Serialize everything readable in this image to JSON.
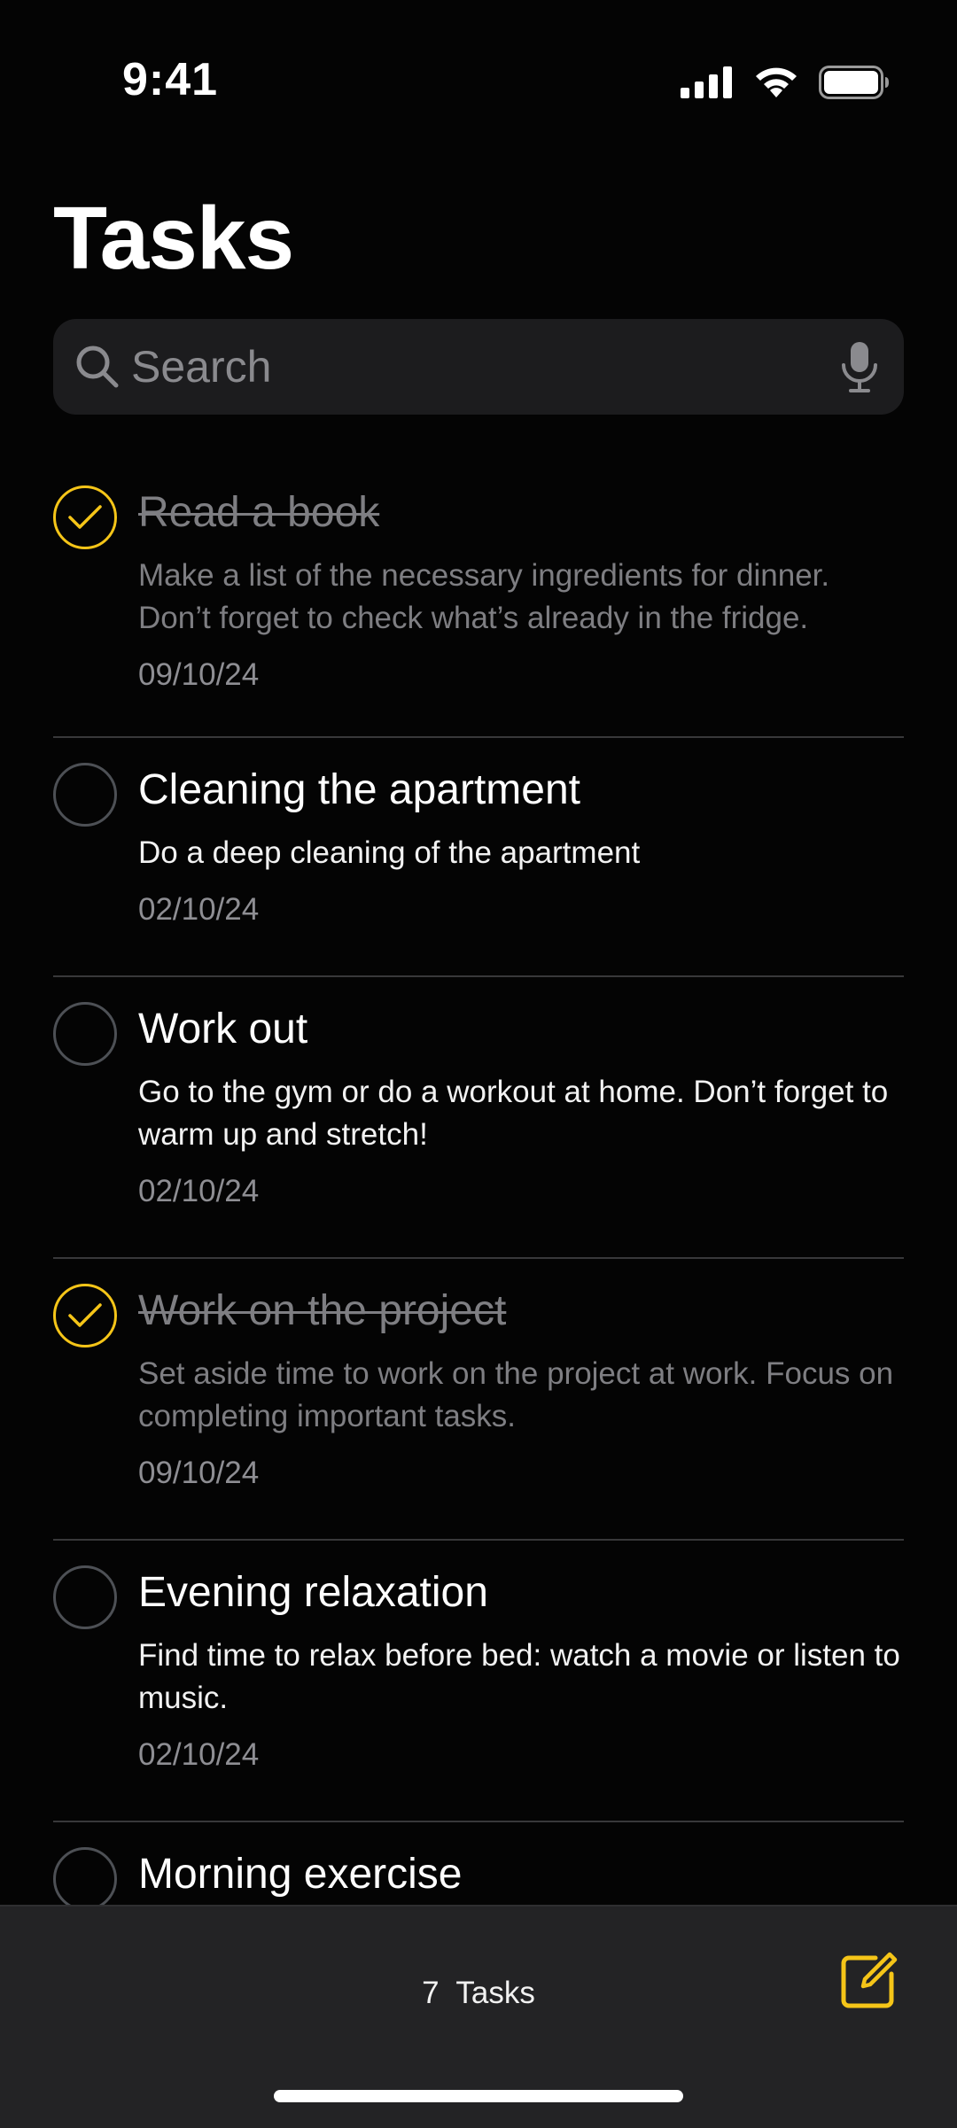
{
  "status_bar": {
    "time": "9:41",
    "icons": [
      "cellular-signal-icon",
      "wifi-icon",
      "battery-icon"
    ]
  },
  "header": {
    "title": "Tasks"
  },
  "search": {
    "placeholder": "Search",
    "value": "",
    "icon": "search-icon",
    "mic_icon": "microphone-icon"
  },
  "tasks": [
    {
      "title": "Read a book",
      "description": "Make a list of the necessary ingredients for dinner. Don’t forget to check what’s already in the fridge.",
      "date": "09/10/24",
      "completed": true
    },
    {
      "title": "Cleaning the apartment",
      "description": "Do a deep cleaning of the apartment",
      "date": "02/10/24",
      "completed": false
    },
    {
      "title": "Work out",
      "description": "Go to the gym or do a workout at home. Don’t forget to warm up and stretch!",
      "date": "02/10/24",
      "completed": false
    },
    {
      "title": "Work on the project",
      "description": "Set aside time to work on the project at work. Focus on completing important tasks.",
      "date": "09/10/24",
      "completed": true
    },
    {
      "title": "Evening relaxation",
      "description": "Find time to relax before bed: watch a movie or listen to music.",
      "date": "02/10/24",
      "completed": false
    },
    {
      "title": "Morning exercise",
      "description": "",
      "date": "",
      "completed": false
    }
  ],
  "toolbar": {
    "task_count": "7  Tasks",
    "compose_icon": "compose-icon"
  },
  "colors": {
    "background": "#040404",
    "accent": "#f5c518",
    "search_bg": "#1c1c1e",
    "toolbar_bg": "#232325",
    "muted_text": "#8e8e93",
    "divider": "#38383a"
  }
}
